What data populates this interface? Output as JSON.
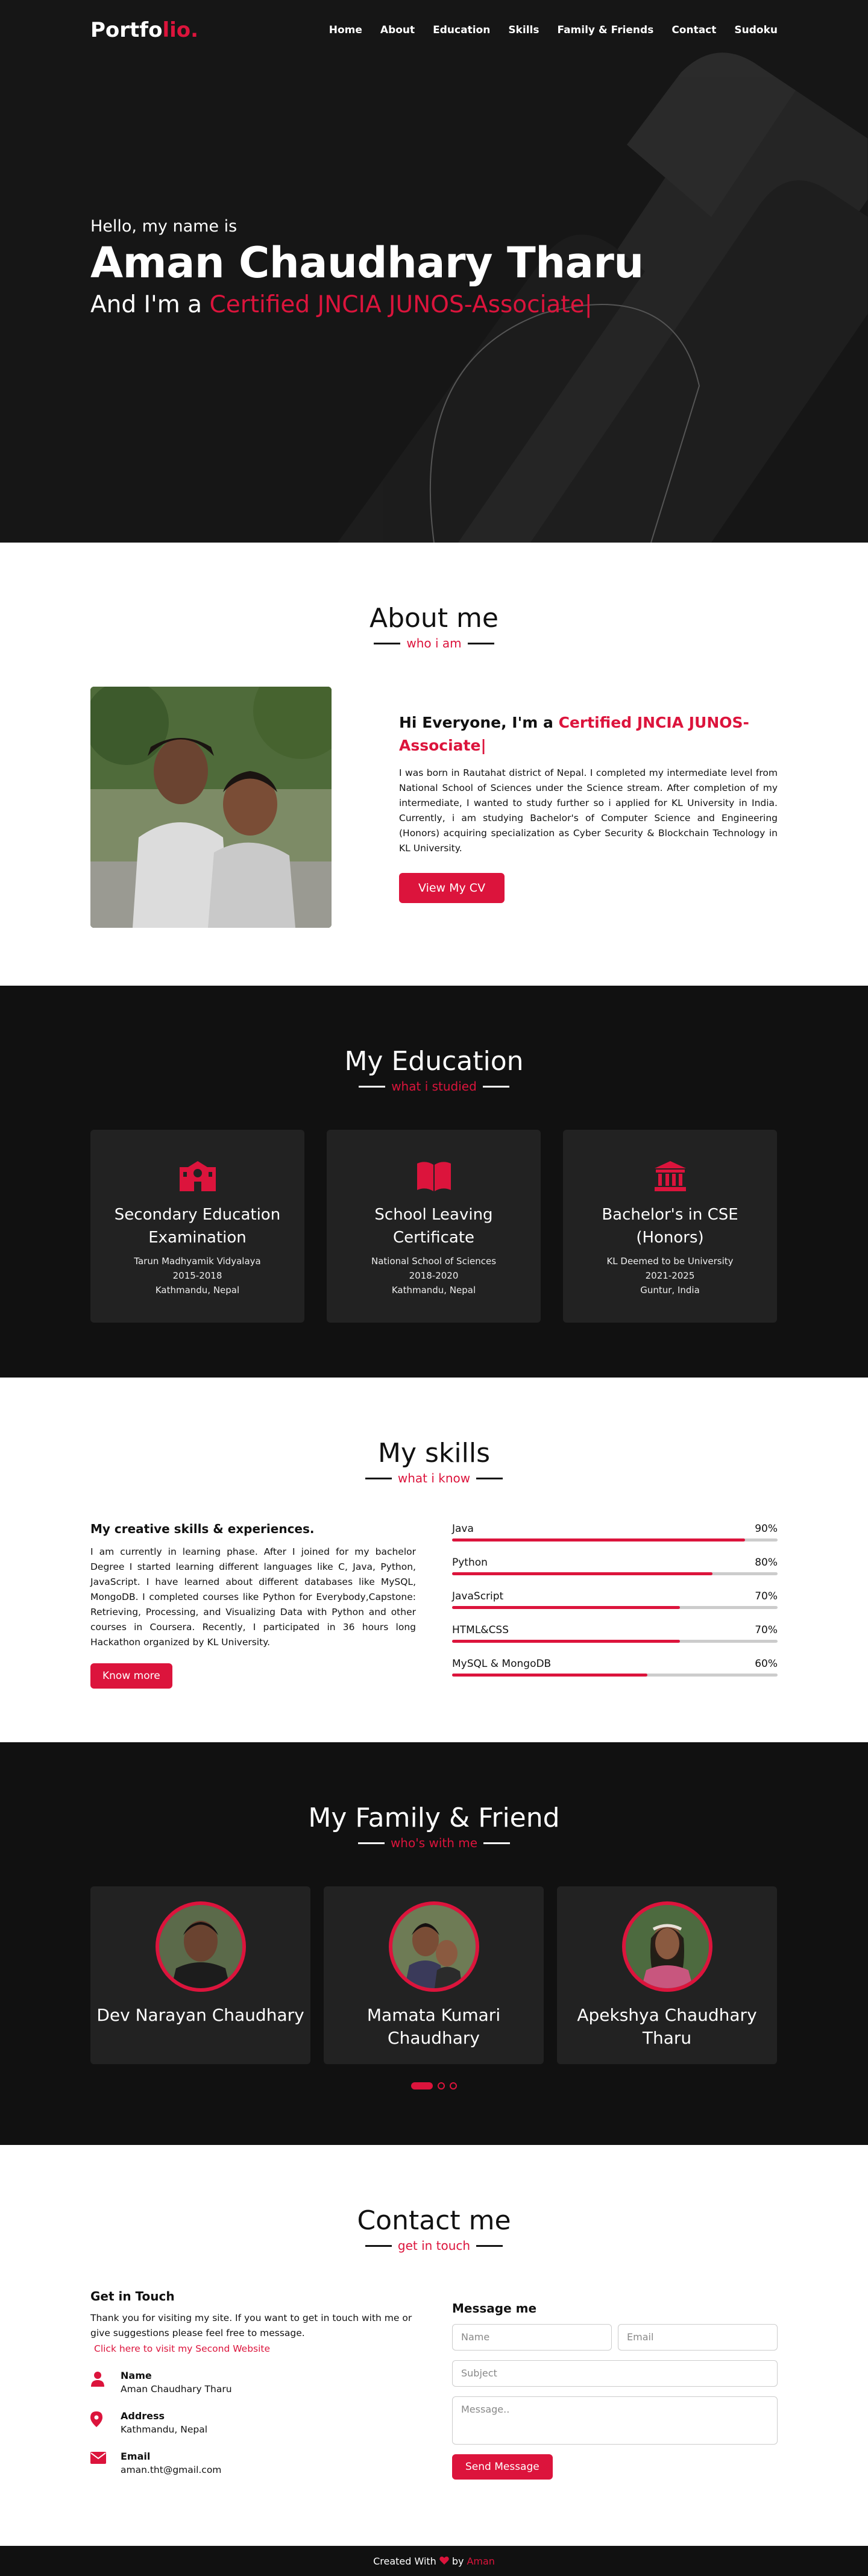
{
  "nav": {
    "logo_main": "Portfo",
    "logo_accent": "lio.",
    "items": [
      "Home",
      "About",
      "Education",
      "Skills",
      "Family & Friends",
      "Contact",
      "Sudoku"
    ]
  },
  "hero": {
    "greeting": "Hello, my name is",
    "name": "Aman Chaudhary Tharu",
    "role_prefix": "And I'm a ",
    "role": "Certified JNCIA JUNOS-Associate|"
  },
  "about": {
    "title": "About me",
    "subtitle": "who i am",
    "heading_prefix": "Hi Everyone, I'm a ",
    "heading_role": "Certified JNCIA JUNOS-Associate|",
    "paragraph": "I was born in Rautahat district of Nepal. I completed my intermediate level from National School of Sciences under the Science stream. After completion of my intermediate, I wanted to study further so i applied for KL University in India. Currently, i am studying Bachelor's of Computer Science and Engineering (Honors) acquiring specialization as Cyber Security & Blockchain Technology in KL University.",
    "button": "View My CV"
  },
  "education": {
    "title": "My Education",
    "subtitle": "what i studied",
    "cards": [
      {
        "icon": "school-icon",
        "title": "Secondary Education Examination",
        "school": "Tarun Madhyamik Vidyalaya",
        "years": "2015-2018",
        "place": "Kathmandu, Nepal"
      },
      {
        "icon": "book-icon",
        "title": "School Leaving Certificate",
        "school": "National School of Sciences",
        "years": "2018-2020",
        "place": "Kathmandu, Nepal"
      },
      {
        "icon": "university-icon",
        "title": "Bachelor's in CSE (Honors)",
        "school": "KL Deemed to be University",
        "years": "2021-2025",
        "place": "Guntur, India"
      }
    ]
  },
  "skills": {
    "title": "My skills",
    "subtitle": "what i know",
    "heading": "My creative skills & experiences.",
    "paragraph": "I am currently in learning phase. After I joined for my bachelor Degree I started learning different languages like C, Java, Python, JavaScript. I have learned about different databases like MySQL, MongoDB. I completed courses like Python for Everybody,Capstone: Retrieving, Processing, and Visualizing Data with Python and other courses in Coursera. Recently, I participated in 36 hours long Hackathon organized by KL University.",
    "button": "Know more",
    "bars": [
      {
        "name": "Java",
        "percent": "90%",
        "level": 0.9
      },
      {
        "name": "Python",
        "percent": "80%",
        "level": 0.8
      },
      {
        "name": "JavaScript",
        "percent": "70%",
        "level": 0.7
      },
      {
        "name": "HTML&CSS",
        "percent": "70%",
        "level": 0.7
      },
      {
        "name": "MySQL & MongoDB",
        "percent": "60%",
        "level": 0.6
      }
    ]
  },
  "family": {
    "title": "My Family & Friend",
    "subtitle": "who's with me",
    "members": [
      {
        "name": "Dev Narayan Chaudhary"
      },
      {
        "name": "Mamata Kumari Chaudhary"
      },
      {
        "name": "Apekshya Chaudhary Tharu"
      }
    ]
  },
  "contact": {
    "title": "Contact me",
    "subtitle": "get in touch",
    "heading": "Get in Touch",
    "paragraph": "Thank you for visiting my site. If you want to get in touch with me or give suggestions please feel free to message.",
    "link": "Click here to visit my Second Website",
    "name_label": "Name",
    "name_value": "Aman Chaudhary Tharu",
    "address_label": "Address",
    "address_value": "Kathmandu, Nepal",
    "email_label": "Email",
    "email_value": "aman.tht@gmail.com",
    "form_heading": "Message me",
    "name_placeholder": "Name",
    "email_placeholder": "Email",
    "subject_placeholder": "Subject",
    "message_placeholder": "Message..",
    "send_button": "Send Message"
  },
  "footer": {
    "prefix": "Created With",
    "by": "by",
    "author": "Aman"
  },
  "colors": {
    "accent": "#dc143c",
    "dark": "#111111",
    "card": "#222222"
  }
}
